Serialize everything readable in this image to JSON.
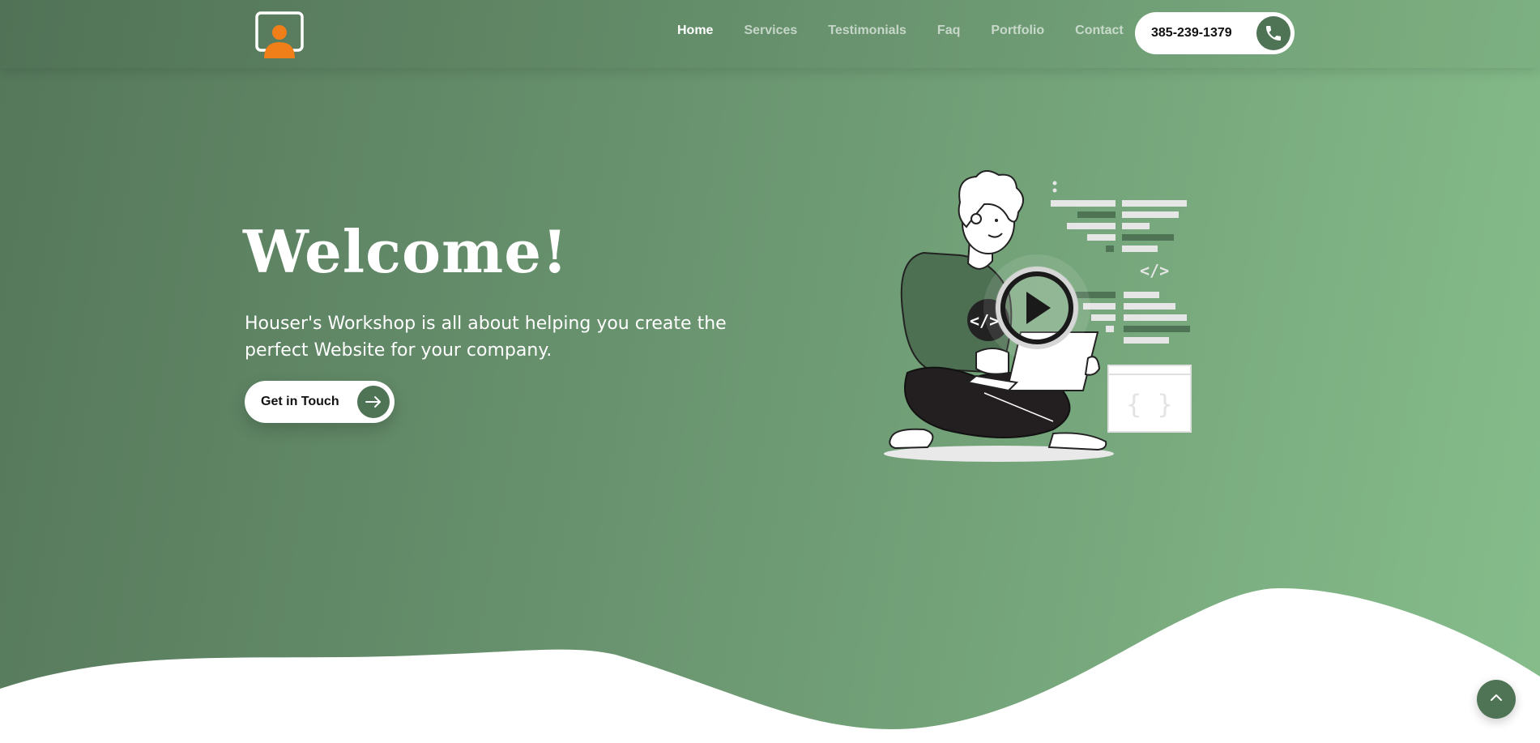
{
  "nav": {
    "items": [
      {
        "label": "Home",
        "active": true
      },
      {
        "label": "Services",
        "active": false
      },
      {
        "label": "Testimonials",
        "active": false
      },
      {
        "label": "Faq",
        "active": false
      },
      {
        "label": "Portfolio",
        "active": false
      },
      {
        "label": "Contact",
        "active": false
      }
    ],
    "phone": "385-239-1379",
    "phone_icon": "phone-icon",
    "logo_icon": "person-monitor-logo"
  },
  "hero": {
    "title": "Welcome!",
    "subtitle": "Houser's Workshop is all about helping you create the perfect Website for your company.",
    "cta_label": "Get in Touch",
    "cta_icon": "arrow-right-icon",
    "illustration": {
      "code_tag": "</>",
      "braces": "{ }",
      "play_icon": "play-icon"
    }
  },
  "scroll_top_icon": "chevron-up-icon",
  "colors": {
    "accent": "#4f7355",
    "logo_orange": "#f07f1a",
    "gradient_start": "#55775a",
    "gradient_end": "#86bd8b"
  }
}
